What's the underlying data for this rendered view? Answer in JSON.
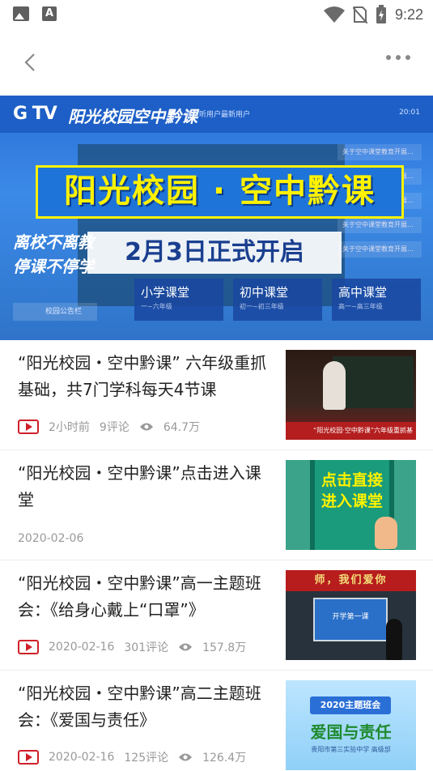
{
  "status_bar": {
    "time": "9:22"
  },
  "banner": {
    "brand": "阳光校园空中黔课",
    "logo": "G TV",
    "notice": "请收听用户最新用户",
    "clock": "20:01",
    "title": "阳光校园 · 空中黔课",
    "date": "2月3日正式开启",
    "left_text_1": "离校不离教",
    "left_text_2": "停课不停学",
    "cards": [
      {
        "label": "小学课堂",
        "sub": "一~六年级"
      },
      {
        "label": "初中课堂",
        "sub": "初一~初三年级"
      },
      {
        "label": "高中课堂",
        "sub": "高一~高三年级"
      }
    ],
    "bulletin": "校园公告栏",
    "side_items": [
      "关于空中课堂教育开展…",
      "关于空中课堂教育开展…",
      "关于空中课堂教育开展…",
      "关于空中课堂教育开展…",
      "关于空中课堂教育开展…"
    ]
  },
  "feed": [
    {
      "title": "“阳光校园・空中黔课” 六年级重抓基础，共7门学科每天4节课",
      "time": "2小时前",
      "comments": "9评论",
      "views": "64.7万",
      "thumb_caption": "“阳光校园·空中黔课”六年级重抓基"
    },
    {
      "title": "“阳光校园・空中黔课”点击进入课堂",
      "time": "2020-02-06",
      "thumb_text": "点击直接进入课堂"
    },
    {
      "title": "“阳光校园・空中黔课”高一主题班会：《给身心戴上“口罩”》",
      "time": "2020-02-16",
      "comments": "301评论",
      "views": "157.8万",
      "thumb_banner": "师，我们爱你",
      "thumb_screen": "开学第一课"
    },
    {
      "title": "“阳光校园・空中黔课”高二主题班会：《爱国与责任》",
      "time": "2020-02-16",
      "comments": "125评论",
      "views": "126.4万",
      "thumb_top": "2020主题班会",
      "thumb_big": "爱国与责任",
      "thumb_sub": "贵阳市第三实验中学 高级部"
    }
  ]
}
